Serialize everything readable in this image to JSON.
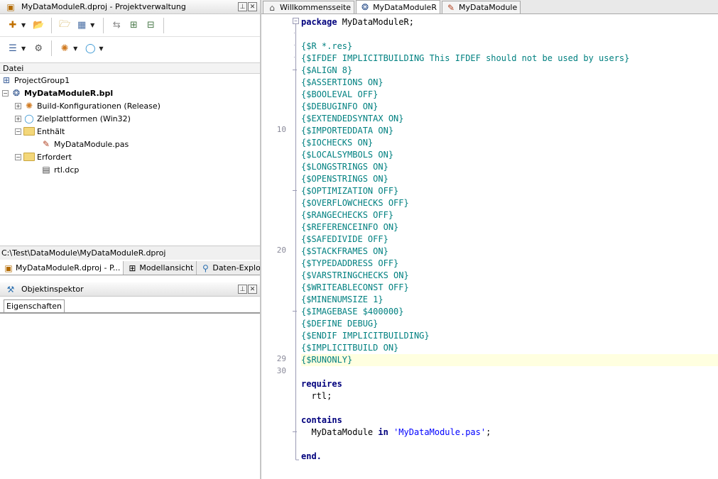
{
  "left_panel": {
    "title": "MyDataModuleR.dproj - Projektverwaltung",
    "header": "Datei",
    "tree": [
      {
        "label": "ProjectGroup1",
        "bold": false
      },
      {
        "label": "MyDataModuleR.bpl",
        "bold": true
      },
      {
        "label": "Build-Konfigurationen (Release)",
        "bold": false
      },
      {
        "label": "Zielplattformen (Win32)",
        "bold": false
      },
      {
        "label": "Enthält",
        "bold": false
      },
      {
        "label": "MyDataModule.pas",
        "bold": false
      },
      {
        "label": "Erfordert",
        "bold": false
      },
      {
        "label": "rtl.dcp",
        "bold": false
      }
    ],
    "path": "C:\\Test\\DataModule\\MyDataModuleR.dproj",
    "bottom_tabs": [
      "MyDataModuleR.dproj - P...",
      "Modellansicht",
      "Daten-Explorer"
    ],
    "inspector_title": "Objektinspektor",
    "inspector_tab": "Eigenschaften"
  },
  "editor": {
    "tabs": [
      "Willkommensseite",
      "MyDataModuleR",
      "MyDataModule"
    ],
    "active_tab": "MyDataModuleR",
    "line_numbers": {
      "l10": "10",
      "l20": "20",
      "l29": "29",
      "l30": "30"
    },
    "code": {
      "c1_kw": "package",
      "c1_rest": " MyDataModuleR;",
      "c3": "{$R *.res}",
      "c4": "{$IFDEF IMPLICITBUILDING This IFDEF should not be used by users}",
      "c5": "{$ALIGN 8}",
      "c6": "{$ASSERTIONS ON}",
      "c7": "{$BOOLEVAL OFF}",
      "c8": "{$DEBUGINFO ON}",
      "c9": "{$EXTENDEDSYNTAX ON}",
      "c10": "{$IMPORTEDDATA ON}",
      "c11": "{$IOCHECKS ON}",
      "c12": "{$LOCALSYMBOLS ON}",
      "c13": "{$LONGSTRINGS ON}",
      "c14": "{$OPENSTRINGS ON}",
      "c15": "{$OPTIMIZATION OFF}",
      "c16": "{$OVERFLOWCHECKS OFF}",
      "c17": "{$RANGECHECKS OFF}",
      "c18": "{$REFERENCEINFO ON}",
      "c19": "{$SAFEDIVIDE OFF}",
      "c20": "{$STACKFRAMES ON}",
      "c21": "{$TYPEDADDRESS OFF}",
      "c22": "{$VARSTRINGCHECKS ON}",
      "c23": "{$WRITEABLECONST OFF}",
      "c24": "{$MINENUMSIZE 1}",
      "c25": "{$IMAGEBASE $400000}",
      "c26": "{$DEFINE DEBUG}",
      "c27": "{$ENDIF IMPLICITBUILDING}",
      "c28": "{$IMPLICITBUILD ON}",
      "c29": "{$RUNONLY}",
      "c31": "requires",
      "c32": "  rtl;",
      "c34": "contains",
      "c35_a": "  MyDataModule ",
      "c35_in": "in",
      "c35_sp": " ",
      "c35_str": "'MyDataModule.pas'",
      "c35_end": ";",
      "c37": "end."
    }
  }
}
